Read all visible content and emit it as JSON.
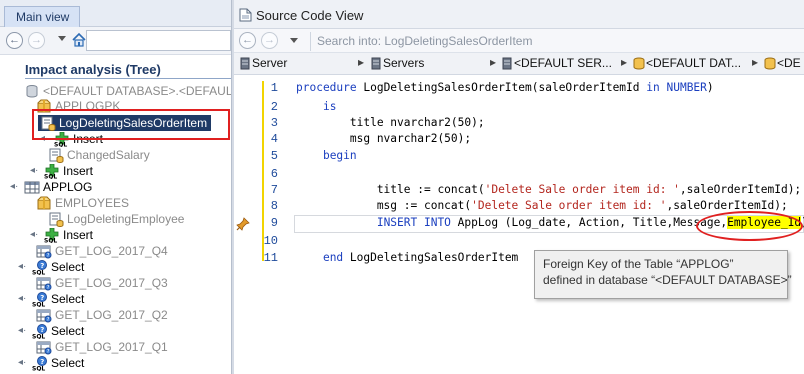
{
  "left_pane": {
    "tab_label": "Main view",
    "nav": {
      "back_glyph": "←",
      "forward_glyph": "→"
    },
    "panel_title": "Impact analysis (Tree)",
    "tree": [
      {
        "label": "<DEFAULT DATABASE>.<DEFAULT",
        "icon": "database-icon",
        "dim": true
      },
      {
        "label": "APPLOGPK",
        "icon": "package-icon",
        "dim": true
      },
      {
        "label": "LogDeletingSalesOrderItem",
        "icon": "procedure-icon",
        "selected": true
      },
      {
        "label": "Insert",
        "icon": "sql-insert-icon"
      },
      {
        "label": "ChangedSalary",
        "icon": "procedure-icon",
        "dim": true
      },
      {
        "label": "Insert",
        "icon": "sql-insert-icon"
      },
      {
        "label": "APPLOG",
        "icon": "table-icon"
      },
      {
        "label": "EMPLOYEES",
        "icon": "package-icon",
        "dim": true
      },
      {
        "label": "LogDeletingEmployee",
        "icon": "procedure-icon",
        "dim": true
      },
      {
        "label": "Insert",
        "icon": "sql-insert-icon"
      },
      {
        "label": "GET_LOG_2017_Q4",
        "icon": "query-icon",
        "dim": true
      },
      {
        "label": "Select",
        "icon": "sql-select-icon"
      },
      {
        "label": "GET_LOG_2017_Q3",
        "icon": "query-icon",
        "dim": true
      },
      {
        "label": "Select",
        "icon": "sql-select-icon"
      },
      {
        "label": "GET_LOG_2017_Q2",
        "icon": "query-icon",
        "dim": true
      },
      {
        "label": "Select",
        "icon": "sql-select-icon"
      },
      {
        "label": "GET_LOG_2017_Q1",
        "icon": "query-icon",
        "dim": true
      },
      {
        "label": "Select",
        "icon": "sql-select-icon"
      }
    ]
  },
  "right_pane": {
    "title": "Source Code View",
    "search_placeholder": "Search into: LogDeletingSalesOrderItem",
    "breadcrumbs": [
      {
        "label": "Server",
        "icon": "server-icon"
      },
      {
        "label": "Servers",
        "icon": "server-icon"
      },
      {
        "label": "<DEFAULT SER...",
        "icon": "server-icon"
      },
      {
        "label": "<DEFAULT DAT...",
        "icon": "database-icon"
      },
      {
        "label": "<DE",
        "icon": "database-icon"
      }
    ],
    "code": [
      {
        "n": "1",
        "tokens": [
          {
            "t": "procedure",
            "k": "kw"
          },
          {
            "t": " LogDeletingSalesOrderItem(saleOrderItemId "
          },
          {
            "t": "in",
            "k": "kw"
          },
          {
            "t": " "
          },
          {
            "t": "NUMBER",
            "k": "kw"
          },
          {
            "t": ")"
          }
        ]
      },
      {
        "n": "2",
        "tokens": [
          {
            "t": "    "
          },
          {
            "t": "is",
            "k": "kw"
          }
        ]
      },
      {
        "n": "3",
        "tokens": [
          {
            "t": "        title nvarchar2(50);"
          }
        ]
      },
      {
        "n": "4",
        "tokens": [
          {
            "t": "        msg nvarchar2(50);"
          }
        ]
      },
      {
        "n": "5",
        "tokens": [
          {
            "t": "    "
          },
          {
            "t": "begin",
            "k": "kw"
          }
        ]
      },
      {
        "n": "6",
        "tokens": []
      },
      {
        "n": "7",
        "tokens": [
          {
            "t": "            title := concat("
          },
          {
            "t": "'Delete Sale order item id: '",
            "k": "str"
          },
          {
            "t": ",saleOrderItemId);"
          }
        ]
      },
      {
        "n": "8",
        "tokens": [
          {
            "t": "            msg := concat("
          },
          {
            "t": "'Delete Sale order item id: '",
            "k": "str"
          },
          {
            "t": ",saleOrderItemId);"
          }
        ]
      },
      {
        "n": "9",
        "tokens": [
          {
            "t": "            "
          },
          {
            "t": "INSERT INTO",
            "k": "kw"
          },
          {
            "t": " AppLog (Log_date, Action, Title,Message,"
          },
          {
            "t": "Employee_Id",
            "k": "hl"
          },
          {
            "t": ")"
          }
        ]
      },
      {
        "n": "10",
        "tokens": []
      },
      {
        "n": "11",
        "tokens": [
          {
            "t": "    "
          },
          {
            "t": "end",
            "k": "kw"
          },
          {
            "t": " LogDeletingSalesOrderItem"
          }
        ]
      }
    ],
    "tooltip": {
      "line1": "Foreign Key of the Table “APPLOG”",
      "line2": "defined in database “<DEFAULT DATABASE>”"
    }
  },
  "colors": {
    "accent": "#1f3a66",
    "highlight": "#ffff00",
    "annotation": "#e02020",
    "keyword": "#1b3fbf",
    "string": "#b3261e"
  }
}
